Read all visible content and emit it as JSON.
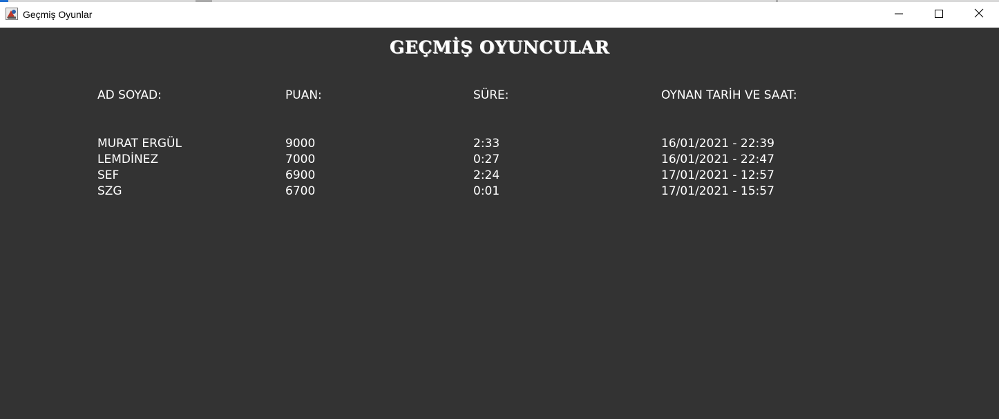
{
  "window": {
    "title": "Geçmiş Oyunlar"
  },
  "page": {
    "heading": "GEÇMİŞ OYUNCULAR"
  },
  "table": {
    "headers": [
      "AD SOYAD:",
      "PUAN:",
      "SÜRE:",
      "OYNAN TARİH VE SAAT:"
    ],
    "rows": [
      [
        "MURAT ERGÜL",
        "9000",
        "2:33",
        "16/01/2021 - 22:39"
      ],
      [
        "LEMDİNEZ",
        "7000",
        "0:27",
        "16/01/2021 - 22:47"
      ],
      [
        "SEF",
        "6900",
        "2:24",
        "17/01/2021 - 12:57"
      ],
      [
        "SZG",
        "6700",
        "0:01",
        "17/01/2021 - 15:57"
      ]
    ]
  },
  "colors": {
    "background": "#333333",
    "text": "#ffffff",
    "titlebar": "#ffffff"
  },
  "icons": {
    "app": "app-icon",
    "minimize": "minimize-icon",
    "maximize": "maximize-icon",
    "close": "close-icon"
  }
}
